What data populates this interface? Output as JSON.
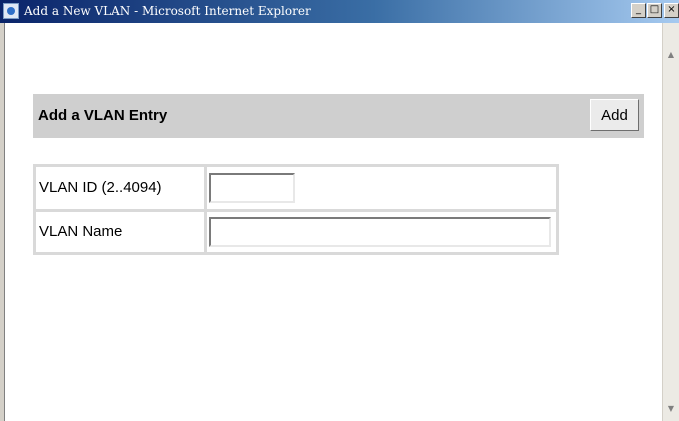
{
  "window": {
    "title": "Add a New VLAN - Microsoft Internet Explorer",
    "minimize_glyph": "_",
    "maximize_glyph": "□",
    "close_glyph": "×"
  },
  "scrollbar": {
    "up_glyph": "▲",
    "down_glyph": "▼"
  },
  "section": {
    "title": "Add a VLAN Entry",
    "add_label": "Add"
  },
  "form": {
    "fields": [
      {
        "label": "VLAN ID (2..4094)",
        "value": "",
        "placeholder": ""
      },
      {
        "label": "VLAN Name",
        "value": "",
        "placeholder": ""
      }
    ]
  },
  "colors": {
    "header_bar": "#cfcfcf",
    "title_bar_start": "#0a246a",
    "title_bar_end": "#a6caf0"
  },
  "icons": {
    "app": "internet-explorer-icon"
  }
}
